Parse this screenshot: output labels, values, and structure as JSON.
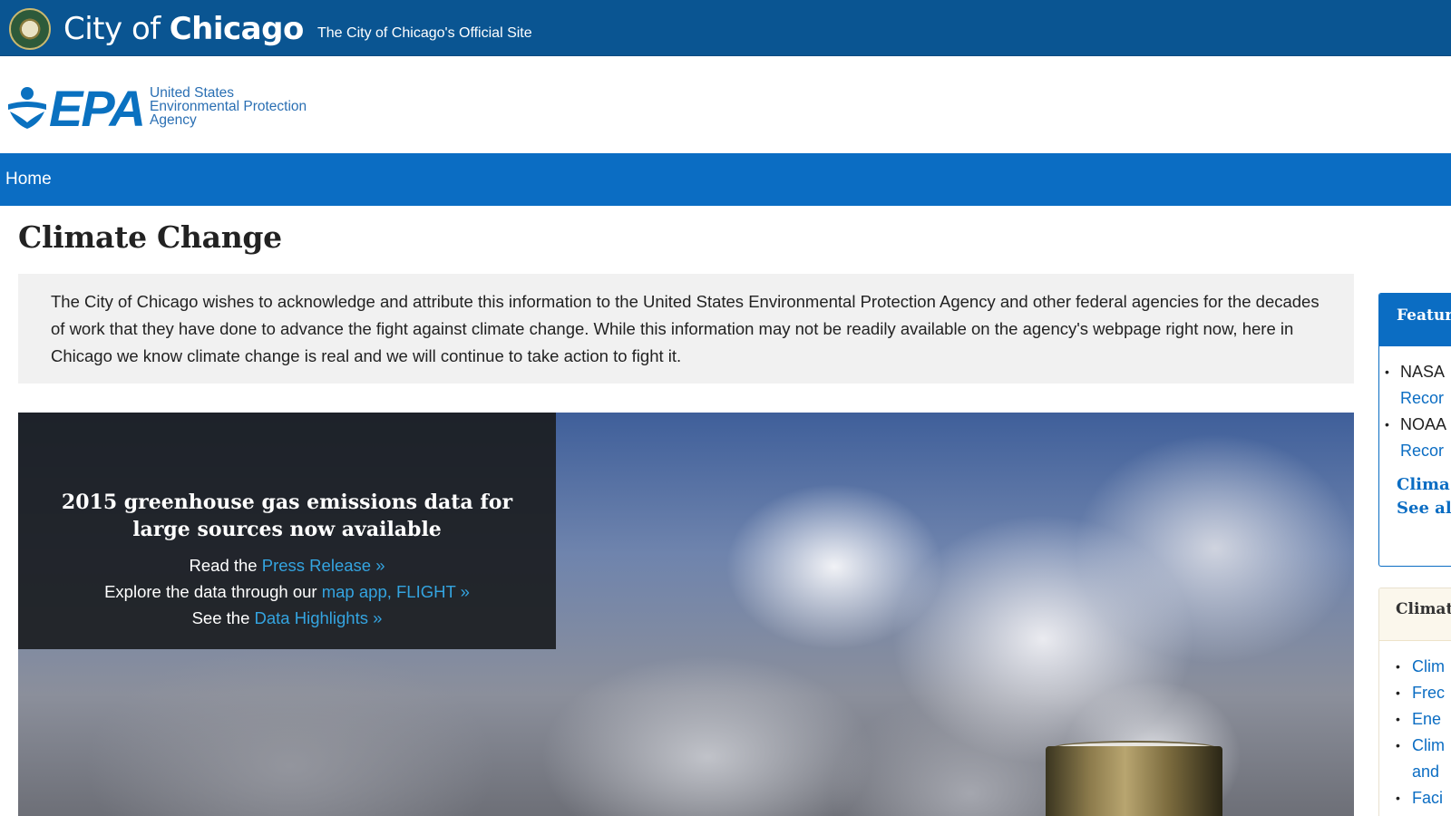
{
  "city_bar": {
    "title_light": "City of",
    "title_bold": "Chicago",
    "subtitle": "The City of Chicago's Official Site",
    "seal_icon": "city-seal-icon"
  },
  "epa_header": {
    "wordmark": "EPA",
    "agency_lines": [
      "United States",
      "Environmental Protection",
      "Agency"
    ],
    "brand_color": "#0a71c0"
  },
  "nav": {
    "home": "Home",
    "color": "#0b6dc3"
  },
  "page": {
    "title": "Climate Change",
    "notice": "The City of Chicago wishes to acknowledge and attribute this information to the United States Environmental Protection Agency and other federal agencies for the decades of work that they have done to advance the fight against climate change. While this information may not be readily available on the agency's webpage right now, here in Chicago we know climate change is real and we will continue to take action to fight it."
  },
  "hero": {
    "heading": "2015 greenhouse gas emissions data for large sources now available",
    "line1_prefix": "Read the ",
    "line1_link": "Press Release »",
    "line2_prefix": "Explore the data through our ",
    "line2_link": "map app, FLIGHT »",
    "line3_prefix": "See the ",
    "line3_link": "Data Highlights »"
  },
  "sidebar": {
    "featured": {
      "heading": "Featur",
      "items": [
        {
          "label": "NASA",
          "link": "Recor"
        },
        {
          "label": "NOAA",
          "link": "Recor"
        }
      ],
      "links": [
        "Clima",
        "See al"
      ]
    },
    "climate": {
      "heading": "Climat",
      "items": [
        {
          "label": "Clim"
        },
        {
          "label": "Frec"
        },
        {
          "label": "Ene"
        },
        {
          "label": "Clim",
          "cont": "and"
        },
        {
          "label": "Faci"
        }
      ]
    }
  }
}
